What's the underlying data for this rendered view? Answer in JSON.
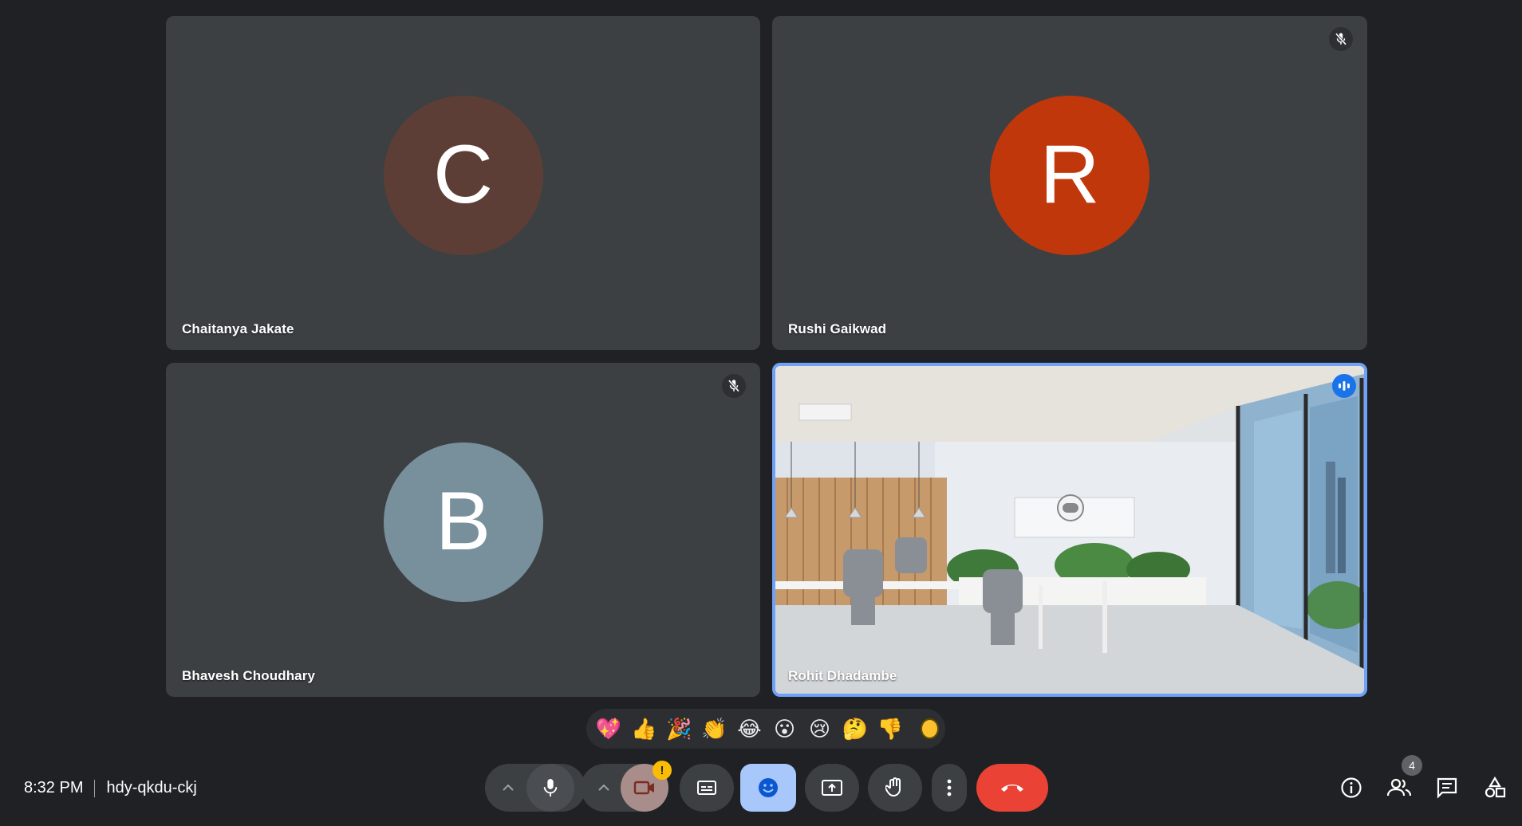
{
  "participants": [
    {
      "name": "Chaitanya Jakate",
      "initial": "C",
      "avatar_color": "#5d3e36",
      "muted": false
    },
    {
      "name": "Rushi Gaikwad",
      "initial": "R",
      "avatar_color": "#c0370b",
      "muted": true
    },
    {
      "name": "Bhavesh Choudhary",
      "initial": "B",
      "avatar_color": "#78909c",
      "muted": true
    },
    {
      "name": "Rohit Dhadambe",
      "video": true,
      "speaking": true
    }
  ],
  "reactions": [
    "💖",
    "👍",
    "🎉",
    "👏",
    "😂",
    "😮",
    "😢",
    "🤔",
    "👎"
  ],
  "skin_tone_color": "#fbc02d",
  "meeting": {
    "time": "8:32 PM",
    "code": "hdy-qkdu-ckj"
  },
  "controls": {
    "camera_warning": "!",
    "people_count": "4"
  },
  "colors": {
    "background": "#202124",
    "tile": "#3c4043",
    "accent_blue": "#1a73e8",
    "emoji_button_active": "#a8c7fa",
    "end_call": "#ea4335"
  }
}
